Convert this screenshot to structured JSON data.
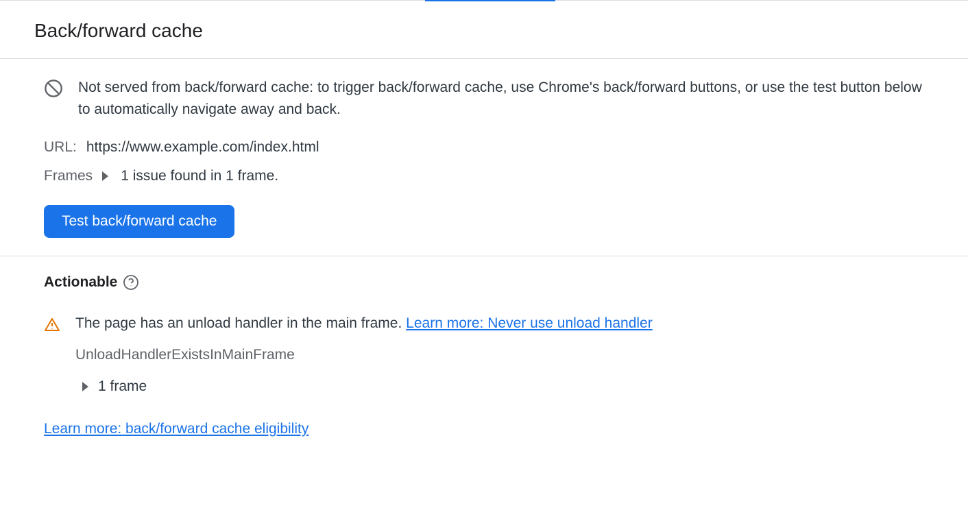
{
  "header": {
    "title": "Back/forward cache"
  },
  "main": {
    "status_message": "Not served from back/forward cache: to trigger back/forward cache, use Chrome's back/forward buttons, or use the test button below to automatically navigate away and back.",
    "url_label": "URL:",
    "url_value": "https://www.example.com/index.html",
    "frames_label": "Frames",
    "frames_summary": "1 issue found in 1 frame.",
    "test_button_label": "Test back/forward cache"
  },
  "actionable": {
    "heading": "Actionable",
    "issues": [
      {
        "message": "The page has an unload handler in the main frame.",
        "learn_more_label": "Learn more: Never use unload handler",
        "reason_code": "UnloadHandlerExistsInMainFrame",
        "frame_count_label": "1 frame"
      }
    ],
    "eligibility_link_label": "Learn more: back/forward cache eligibility"
  }
}
